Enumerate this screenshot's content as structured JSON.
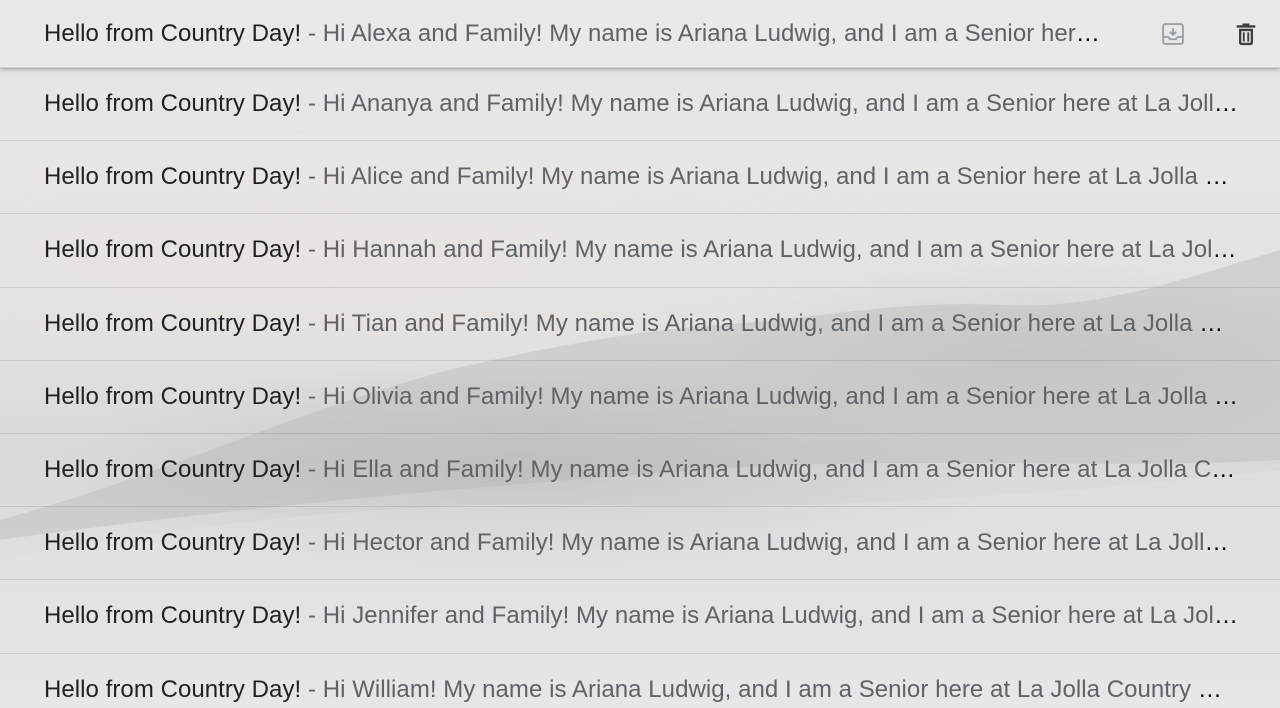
{
  "messages": [
    {
      "subject": "Hello from Country Day!",
      "separator": " - ",
      "snippet": "Hi Alexa and Family! My name is Ariana Ludwig, and I am a Senior here at La Jolla Country Day School."
    },
    {
      "subject": "Hello from Country Day!",
      "separator": " - ",
      "snippet": "Hi Ananya and Family! My name is Ariana Ludwig, and I am a Senior here at La Jolla Country Day School."
    },
    {
      "subject": "Hello from Country Day!",
      "separator": " - ",
      "snippet": "Hi Alice and Family! My name is Ariana Ludwig, and I am a Senior here at La Jolla Country Day School."
    },
    {
      "subject": "Hello from Country Day!",
      "separator": " - ",
      "snippet": "Hi Hannah and Family! My name is Ariana Ludwig, and I am a Senior here at La Jolla Country Day School."
    },
    {
      "subject": "Hello from Country Day!",
      "separator": " - ",
      "snippet": "Hi Tian and Family! My name is Ariana Ludwig, and I am a Senior here at La Jolla Country Day School."
    },
    {
      "subject": "Hello from Country Day!",
      "separator": " - ",
      "snippet": "Hi Olivia and Family! My name is Ariana Ludwig, and I am a Senior here at La Jolla Country Day School."
    },
    {
      "subject": "Hello from Country Day!",
      "separator": " - ",
      "snippet": "Hi Ella and Family! My name is Ariana Ludwig, and I am a Senior here at La Jolla Country Day School."
    },
    {
      "subject": "Hello from Country Day!",
      "separator": " - ",
      "snippet": "Hi Hector and Family! My name is Ariana Ludwig, and I am a Senior here at La Jolla Country Day School."
    },
    {
      "subject": "Hello from Country Day!",
      "separator": " - ",
      "snippet": "Hi Jennifer and Family! My name is Ariana Ludwig, and I am a Senior here at La Jolla Country Day School."
    },
    {
      "subject": "Hello from Country Day!",
      "separator": " - ",
      "snippet": "Hi William! My name is Ariana Ludwig, and I am a Senior here at La Jolla Country Day School."
    }
  ],
  "hover_actions": {
    "archive_icon": "archive-icon",
    "delete_icon": "trash-icon"
  },
  "colors": {
    "subject_text": "#202124",
    "snippet_text": "#5f6368",
    "icon": "#5f6368"
  }
}
